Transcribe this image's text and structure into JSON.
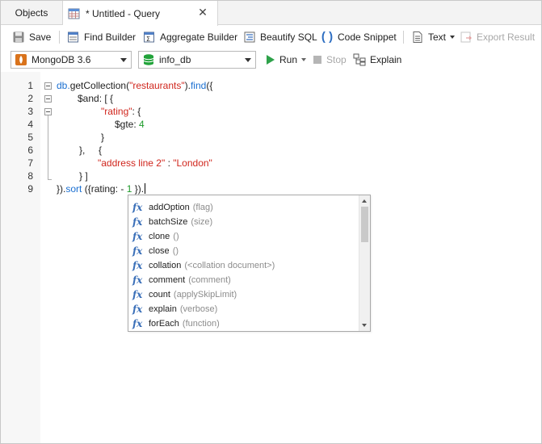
{
  "tabs": [
    {
      "label": "Objects"
    },
    {
      "label": "* Untitled - Query"
    }
  ],
  "toolbar": {
    "save": "Save",
    "find_builder": "Find Builder",
    "aggregate_builder": "Aggregate Builder",
    "beautify": "Beautify SQL",
    "code_snippet": "Code Snippet",
    "text": "Text",
    "export_result": "Export Result"
  },
  "run_bar": {
    "connection": "MongoDB 3.6",
    "database": "info_db",
    "run": "Run",
    "stop": "Stop",
    "explain": "Explain"
  },
  "editor": {
    "line_numbers": [
      "1",
      "2",
      "3",
      "4",
      "5",
      "6",
      "7",
      "8",
      "9"
    ],
    "lines": {
      "l1a": "db.",
      "l1b": "getCollection",
      "l1c": "(",
      "l1d": "\"restaurants\"",
      "l1e": ").",
      "l1f": "find",
      "l1g": "({",
      "l2": "$and: [ {",
      "l3a": "\"rating\"",
      "l3b": ": {",
      "l4a": "$gte: ",
      "l4b": "4",
      "l5": "}",
      "l6": "},     {",
      "l7a": "\"address line 2\"",
      "l7b": " : ",
      "l7c": "\"London\"",
      "l8": "} ]",
      "l9a": "}).",
      "l9b": "sort",
      "l9c": " ({rating: - ",
      "l9d": "1",
      "l9e": " })."
    }
  },
  "autocomplete": {
    "items": [
      {
        "name": "addOption",
        "args": "(flag)"
      },
      {
        "name": "batchSize",
        "args": "(size)"
      },
      {
        "name": "clone",
        "args": "()"
      },
      {
        "name": "close",
        "args": "()"
      },
      {
        "name": "collation",
        "args": "(<collation document>)"
      },
      {
        "name": "comment",
        "args": "(comment)"
      },
      {
        "name": "count",
        "args": "(applySkipLimit)"
      },
      {
        "name": "explain",
        "args": "(verbose)"
      },
      {
        "name": "forEach",
        "args": "(function)"
      }
    ]
  },
  "colors": {
    "keyword_blue": "#1a6fd1",
    "string_red": "#d0261d",
    "number_green": "#1d9a2a",
    "run_green": "#2ea24a",
    "db_green": "#22a33a",
    "mongo_orange": "#d9731c"
  },
  "icons": [
    "save-icon",
    "find-builder-icon",
    "aggregate-builder-icon",
    "beautify-icon",
    "code-snippet-icon",
    "text-icon",
    "export-result-icon",
    "mongodb-icon",
    "database-icon",
    "run-icon",
    "stop-icon",
    "explain-icon",
    "query-table-icon",
    "close-icon",
    "function-icon"
  ]
}
